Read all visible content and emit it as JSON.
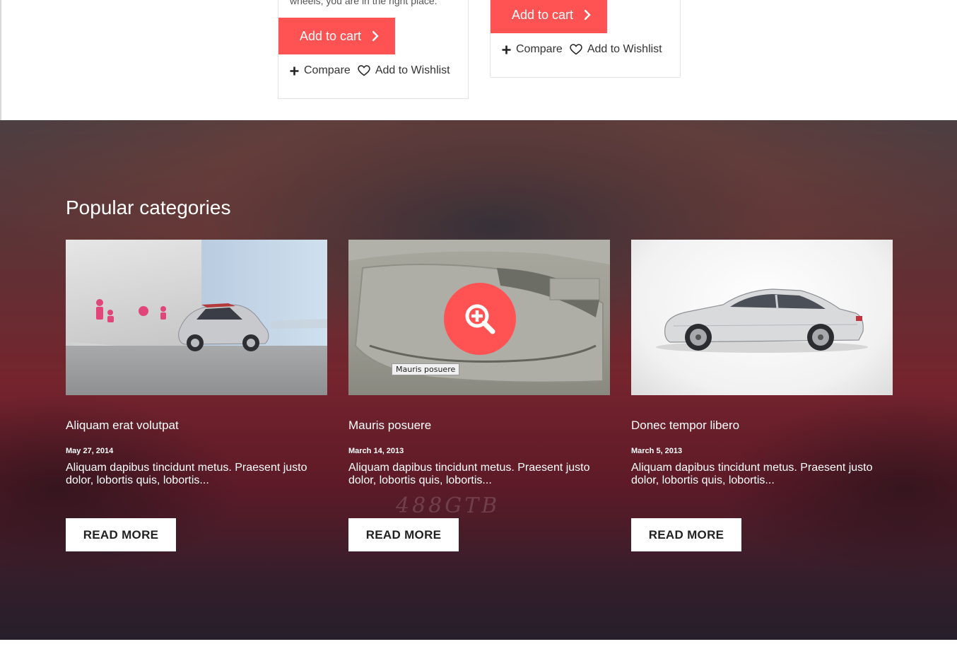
{
  "products": [
    {
      "description": "wheels, you are in the right place.",
      "add_to_cart": "Add to cart",
      "compare": "Compare",
      "wishlist": "Add to Wishlist"
    },
    {
      "add_to_cart": "Add to cart",
      "compare": "Compare",
      "wishlist": "Add to Wishlist"
    }
  ],
  "popular": {
    "title": "Popular categories",
    "plate_text": "488GTB",
    "items": [
      {
        "name": "Aliquam erat volutpat",
        "date": "May 27, 2014",
        "text": "Aliquam dapibus tincidunt metus. Praesent justo dolor, lobortis quis, lobortis...",
        "button": "READ MORE"
      },
      {
        "name": "Mauris posuere",
        "date": "March 14, 2013",
        "text": "Aliquam dapibus tincidunt metus. Praesent justo dolor, lobortis quis, lobortis...",
        "button": "READ MORE",
        "tooltip": "Mauris posuere"
      },
      {
        "name": "Donec tempor libero",
        "date": "March 5, 2013",
        "text": "Aliquam dapibus tincidunt metus. Praesent justo dolor, lobortis quis, lobortis...",
        "button": "READ MORE"
      }
    ]
  },
  "colors": {
    "accent": "#ff5353",
    "text_light": "#ffffff",
    "banner_red": "#8a2a33"
  },
  "icons": {
    "cart_chevron": "chevron-right-icon",
    "compare": "plus-icon",
    "wishlist": "heart-icon",
    "zoom": "zoom-in-icon"
  }
}
